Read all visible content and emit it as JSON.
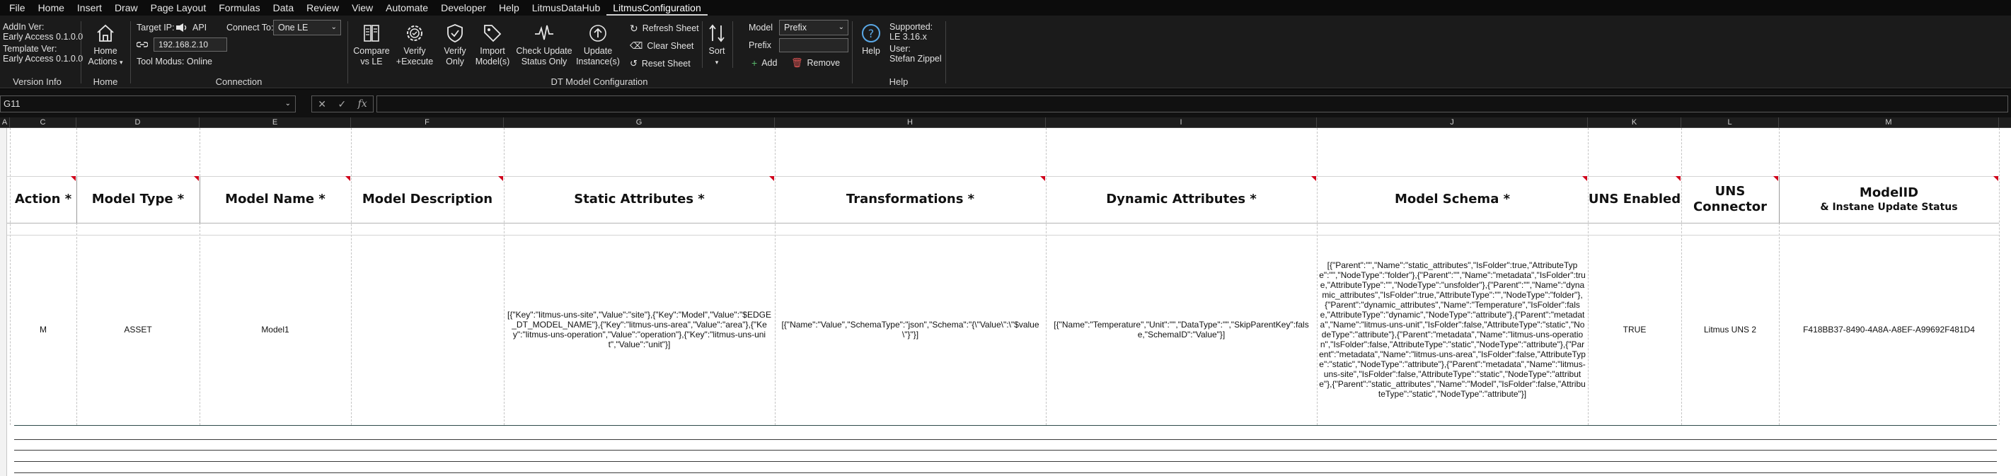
{
  "menu": [
    "File",
    "Home",
    "Insert",
    "Draw",
    "Page Layout",
    "Formulas",
    "Data",
    "Review",
    "View",
    "Automate",
    "Developer",
    "Help",
    "LitmusDataHub",
    "LitmusConfiguration"
  ],
  "menu_active": "LitmusConfiguration",
  "ribbon": {
    "version_info": {
      "addin_label": "AddIn Ver:",
      "addin_value": "Early Access 0.1.0.0",
      "template_label": "Template Ver:",
      "template_value": "Early Access 0.1.0.0",
      "group_label": "Version Info"
    },
    "home": {
      "button_line1": "Home",
      "button_line2": "Actions",
      "group_label": "Home"
    },
    "connection": {
      "target_ip_label": "Target IP:",
      "api_label": "API",
      "connect_to_label": "Connect To:",
      "connect_to_value": "One LE",
      "ip_value": "192.168.2.10",
      "tool_modus": "Tool Modus: Online",
      "group_label": "Connection"
    },
    "dt_model": {
      "compare_line1": "Compare",
      "compare_line2": "vs LE",
      "verify_exec_line1": "Verify",
      "verify_exec_line2": "+Execute",
      "verify_only_line1": "Verify",
      "verify_only_line2": "Only",
      "import_line1": "Import",
      "import_line2": "Model(s)",
      "check_line1": "Check Update",
      "check_line2": "Status Only",
      "update_line1": "Update",
      "update_line2": "Instance(s)",
      "refresh_sheet": "Refresh Sheet",
      "clear_sheet": "Clear Sheet",
      "reset_sheet": "Reset Sheet",
      "sort": "Sort",
      "model_label": "Model",
      "model_value": "Prefix",
      "prefix_label": "Prefix",
      "prefix_value": "",
      "add": "Add",
      "remove": "Remove",
      "group_label": "DT Model Configuration"
    },
    "help": {
      "button": "Help",
      "supported_label": "Supported:",
      "supported_value": "LE 3.16.x",
      "user_label": "User:",
      "user_value": "Stefan Zippel",
      "group_label": "Help"
    }
  },
  "formula_bar": {
    "name_box": "G11",
    "fx": "fx",
    "cancel": "✕",
    "confirm": "✓",
    "value": ""
  },
  "columns": [
    "A",
    "C",
    "D",
    "E",
    "F",
    "G",
    "H",
    "I",
    "J",
    "K",
    "L",
    "M"
  ],
  "table": {
    "headers": {
      "action": "Action *",
      "model_type": "Model Type *",
      "model_name": "Model Name *",
      "model_description": "Model Description",
      "static_attributes": "Static Attributes *",
      "transformations": "Transformations *",
      "dynamic_attributes": "Dynamic Attributes *",
      "model_schema": "Model Schema *",
      "uns_enabled": "UNS Enabled",
      "uns_connector": "UNS Connector",
      "model_id": "ModelID",
      "model_id_sub": "& Instane Update Status"
    },
    "row": {
      "action": "M",
      "model_type": "ASSET",
      "model_name": "Model1",
      "model_description": "",
      "static_attributes": "[{\"Key\":\"litmus-uns-site\",\"Value\":\"site\"},{\"Key\":\"Model\",\"Value\":\"$EDGE_DT_MODEL_NAME\"},{\"Key\":\"litmus-uns-area\",\"Value\":\"area\"},{\"Key\":\"litmus-uns-operation\",\"Value\":\"operation\"},{\"Key\":\"litmus-uns-unit\",\"Value\":\"unit\"}]",
      "transformations": "[{\"Name\":\"Value\",\"SchemaType\":\"json\",\"Schema\":\"{\\\"Value\\\":\\\"$value\\\"}\"}]",
      "dynamic_attributes": "[{\"Name\":\"Temperature\",\"Unit\":\"\",\"DataType\":\"\",\"SkipParentKey\":false,\"SchemaID\":\"Value\"}]",
      "model_schema": "[{\"Parent\":\"\",\"Name\":\"static_attributes\",\"IsFolder\":true,\"AttributeType\":\"\",\"NodeType\":\"folder\"},{\"Parent\":\"\",\"Name\":\"metadata\",\"IsFolder\":true,\"AttributeType\":\"\",\"NodeType\":\"unsfolder\"},{\"Parent\":\"\",\"Name\":\"dynamic_attributes\",\"IsFolder\":true,\"AttributeType\":\"\",\"NodeType\":\"folder\"},{\"Parent\":\"dynamic_attributes\",\"Name\":\"Temperature\",\"IsFolder\":false,\"AttributeType\":\"dynamic\",\"NodeType\":\"attribute\"},{\"Parent\":\"metadata\",\"Name\":\"litmus-uns-unit\",\"IsFolder\":false,\"AttributeType\":\"static\",\"NodeType\":\"attribute\"},{\"Parent\":\"metadata\",\"Name\":\"litmus-uns-operation\",\"IsFolder\":false,\"AttributeType\":\"static\",\"NodeType\":\"attribute\"},{\"Parent\":\"metadata\",\"Name\":\"litmus-uns-area\",\"IsFolder\":false,\"AttributeType\":\"static\",\"NodeType\":\"attribute\"},{\"Parent\":\"metadata\",\"Name\":\"litmus-uns-site\",\"IsFolder\":false,\"AttributeType\":\"static\",\"NodeType\":\"attribute\"},{\"Parent\":\"static_attributes\",\"Name\":\"Model\",\"IsFolder\":false,\"AttributeType\":\"static\",\"NodeType\":\"attribute\"}]",
      "uns_enabled": "TRUE",
      "uns_connector": "Litmus UNS 2",
      "model_id": "F418BB37-8490-4A8A-A8EF-A99692F481D4"
    }
  }
}
